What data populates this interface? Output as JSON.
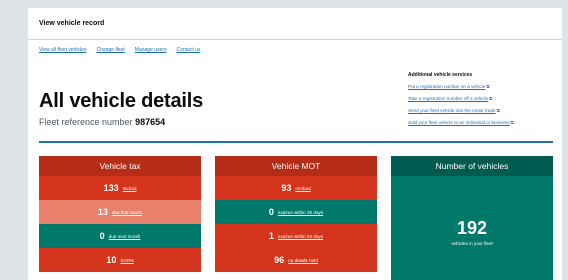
{
  "app": {
    "title": "View vehicle record"
  },
  "nav": [
    {
      "label": "View all fleet vehicles"
    },
    {
      "label": "Change fleet"
    },
    {
      "label": "Manage users"
    },
    {
      "label": "Contact us"
    }
  ],
  "heading": "All vehicle details",
  "fleet": {
    "label": "Fleet reference number",
    "number": "987654"
  },
  "services": {
    "title": "Additional vehicle services",
    "links": [
      {
        "label": "Put a registration number on a vehicle"
      },
      {
        "label": "Take a registration number off a vehicle"
      },
      {
        "label": "Send your fleet vehicle into the motor trade"
      },
      {
        "label": "Sold your fleet vehicle to an individual or business"
      }
    ]
  },
  "cards": {
    "tax": {
      "title": "Vehicle tax",
      "rows": [
        {
          "count": "133",
          "label": "taxbad"
        },
        {
          "count": "13",
          "label": "due this month"
        },
        {
          "count": "0",
          "label": "due next month"
        },
        {
          "count": "10",
          "label": "SORN"
        }
      ]
    },
    "mot": {
      "title": "Vehicle MOT",
      "rows": [
        {
          "count": "93",
          "label": "motbad"
        },
        {
          "count": "0",
          "label": "expires within 30 days"
        },
        {
          "count": "1",
          "label": "expires within 90 days"
        },
        {
          "count": "96",
          "label": "no details held"
        }
      ]
    },
    "vehicles": {
      "title": "Number of vehicles",
      "count": "192",
      "caption": "vehicles in your fleet"
    }
  },
  "colors": {
    "link": "#1d70b8",
    "red": "#d4351c",
    "light_red": "#e9806b",
    "green": "#00703c",
    "teal": "#00796b"
  },
  "icons": {
    "external_link": "external-link-icon"
  }
}
